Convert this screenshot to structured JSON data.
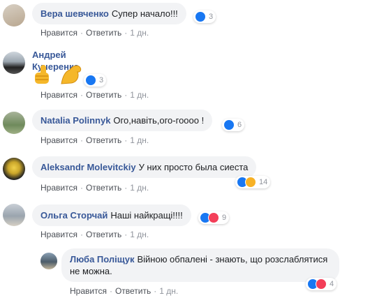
{
  "actions": {
    "like": "Нравится",
    "reply": "Ответить",
    "sep": "·"
  },
  "comments": [
    {
      "author": "Вера шевченко",
      "text": "Супер начало!!!",
      "reactions": "3",
      "time": "1 дн."
    },
    {
      "author": "Андрей Кучеренко",
      "text": "",
      "reactions": "3",
      "time": "1 дн."
    },
    {
      "author": "Natalia Polinnyk",
      "text": "Ого,навіть,ого-гоооо !",
      "reactions": "6",
      "time": "1 дн."
    },
    {
      "author": "Aleksandr Molevitckiy",
      "text": "У них просто была сиеста",
      "reactions": "14",
      "time": "1 дн."
    },
    {
      "author": "Ольга Сторчай",
      "text": "Наші найкращі!!!!",
      "reactions": "9",
      "time": "1 дн."
    }
  ],
  "reply": {
    "author": "Люба Поліщук",
    "text": "Війною обпалені - знають, що розслаблятися не можна.",
    "reactions": "4",
    "time": "1 дн."
  },
  "colors": {
    "like": "#1877f2",
    "love": "#f33e58",
    "haha": "#f7b125",
    "author": "#385898"
  }
}
